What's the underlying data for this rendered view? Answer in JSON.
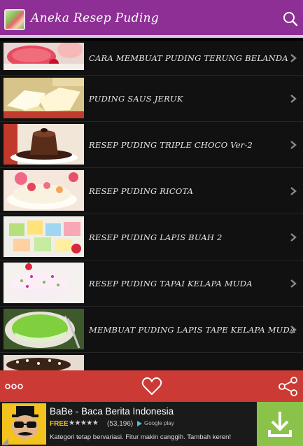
{
  "app": {
    "title": "Aneka Resep Puding",
    "accent_color": "#8e2f95",
    "icons": {
      "search": "search-icon",
      "app": "app-logo"
    }
  },
  "recipes": [
    {
      "title": "CARA MEMBUAT PUDING TERUNG BELANDA",
      "thumb": "puding-terung-belanda-photo"
    },
    {
      "title": "PUDING SAUS JERUK",
      "thumb": "puding-saus-jeruk-photo"
    },
    {
      "title": "RESEP PUDING TRIPLE CHOCO Ver-2",
      "thumb": "puding-triple-choco-photo"
    },
    {
      "title": "RESEP PUDING RICOTA",
      "thumb": "puding-ricota-photo"
    },
    {
      "title": "RESEP PUDING LAPIS BUAH 2",
      "thumb": "puding-lapis-buah-photo"
    },
    {
      "title": "RESEP PUDING TAPAI KELAPA MUDA",
      "thumb": "puding-tapai-kelapa-photo"
    },
    {
      "title": "MEMBUAT PUDING LAPIS TAPE KELAPA MUDA",
      "thumb": "puding-lapis-tape-photo"
    },
    {
      "title": "",
      "thumb": "puding-choco-cake-photo"
    }
  ],
  "bottombar": {
    "color": "#cb3a34",
    "icons": [
      "more-icon",
      "heart-icon",
      "share-icon"
    ]
  },
  "ad": {
    "title": "BaBe - Baca Berita Indonesia",
    "price": "FREE",
    "stars": "★★★★★",
    "rating_count": "(53,196)",
    "store": "Google play",
    "description": "Kategori tetap bervariasi. Fitur makin canggih. Tambah keren!",
    "download_color": "#8bc34a"
  }
}
